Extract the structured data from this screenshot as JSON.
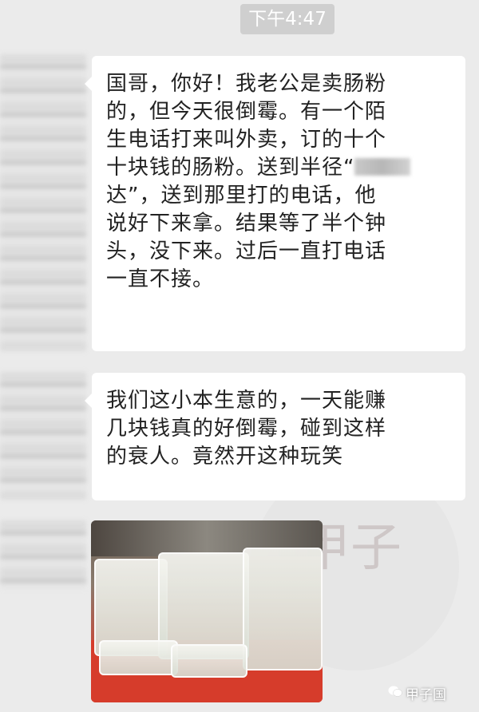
{
  "timestamp": "下午4:47",
  "messages": [
    {
      "lines": [
        "国哥，你好！我老公是卖肠粉",
        "的，但今天很倒霉。有一个陌",
        "生电话打来叫外卖，订的十个",
        "十块钱的肠粉。送到半径“",
        "达”，送到那里打的电话，他",
        "说好下来拿。结果等了半个钟",
        "头，没下来。过后一直打电话",
        "一直不接。"
      ]
    },
    {
      "lines": [
        "我们这小本生意的，一天能赚",
        "几块钱真的好倒霉，碰到这样",
        "的衰人。竟然开这种玩笑"
      ]
    }
  ],
  "watermark": {
    "text": "甲子",
    "brand": "甲子国",
    "icon": "wechat-icon"
  },
  "colors": {
    "background": "#ebebeb",
    "bubble": "#ffffff",
    "timestamp_bg": "#cfcfcf"
  }
}
